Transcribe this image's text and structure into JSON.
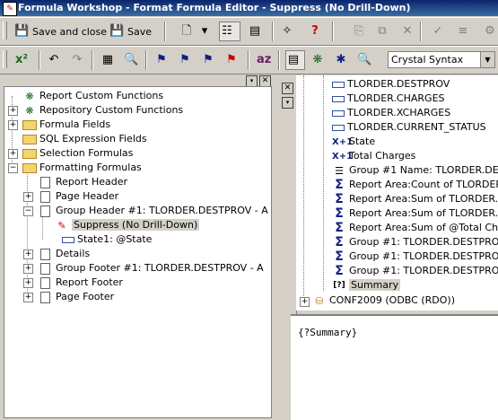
{
  "window": {
    "title": "Formula Workshop - Format Formula Editor - Suppress (No Drill-Down)"
  },
  "toolbar": {
    "save_and_close": "Save and close",
    "save": "Save",
    "syntax_select": "Crystal Syntax"
  },
  "left_tree": [
    {
      "label": "Report Custom Functions"
    },
    {
      "label": "Repository Custom Functions"
    },
    {
      "label": "Formula Fields"
    },
    {
      "label": "SQL Expression Fields"
    },
    {
      "label": "Selection Formulas"
    },
    {
      "label": "Formatting Formulas"
    },
    {
      "label": "Report Header"
    },
    {
      "label": "Page Header"
    },
    {
      "label": "Group Header #1: TLORDER.DESTPROV - A"
    },
    {
      "label": "Suppress (No Drill-Down)"
    },
    {
      "label": "State1: @State"
    },
    {
      "label": "Details"
    },
    {
      "label": "Group Footer #1: TLORDER.DESTPROV - A"
    },
    {
      "label": "Report Footer"
    },
    {
      "label": "Page Footer"
    }
  ],
  "right_tree": [
    {
      "label": "TLORDER.DESTPROV"
    },
    {
      "label": "TLORDER.CHARGES"
    },
    {
      "label": "TLORDER.XCHARGES"
    },
    {
      "label": "TLORDER.CURRENT_STATUS"
    },
    {
      "label": "State"
    },
    {
      "label": "Total Charges"
    },
    {
      "label": "Group #1 Name: TLORDER.DEST"
    },
    {
      "label": "Report Area:Count of TLORDER.B"
    },
    {
      "label": "Report Area:Sum of TLORDER.CH"
    },
    {
      "label": "Report Area:Sum of TLORDER.XC"
    },
    {
      "label": "Report Area:Sum of @Total Charge"
    },
    {
      "label": "Group #1: TLORDER.DESTPROV"
    },
    {
      "label": "Group #1: TLORDER.DESTPROV"
    },
    {
      "label": "Group #1: TLORDER.DESTPROV"
    },
    {
      "label": "Summary"
    },
    {
      "label": "CONF2009 (ODBC (RDO))"
    }
  ],
  "editor": {
    "text": "{?Summary}"
  }
}
